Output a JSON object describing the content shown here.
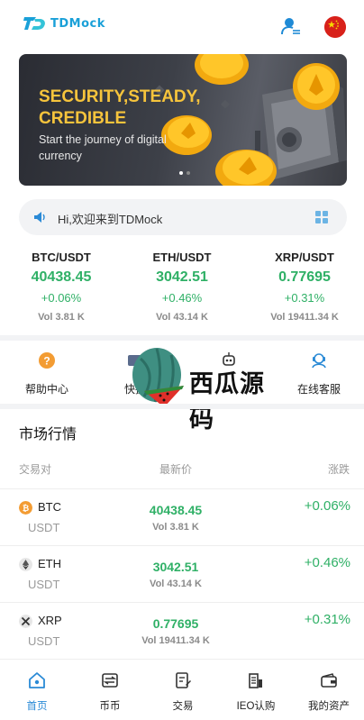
{
  "header": {
    "logo_text": "TDMock",
    "user_icon": "user-list-icon",
    "language_icon": "china-flag-icon"
  },
  "banner": {
    "title": "SECURITY,STEADY, CREDIBLE",
    "subtitle": "Start the journey of digital currency",
    "slides_count": 2,
    "active_slide": 1,
    "accent": "#f6c43c"
  },
  "notice": {
    "text": "Hi,欢迎来到TDMock"
  },
  "tickers": [
    {
      "pair": "BTC/USDT",
      "price": "40438.45",
      "change": "+0.06%",
      "volume": "Vol 3.81 K"
    },
    {
      "pair": "ETH/USDT",
      "price": "3042.51",
      "change": "+0.46%",
      "volume": "Vol 43.14 K"
    },
    {
      "pair": "XRP/USDT",
      "price": "0.77695",
      "change": "+0.31%",
      "volume": "Vol 19411.34 K"
    }
  ],
  "quick_menu": [
    {
      "label": "帮助中心",
      "icon": "help-icon"
    },
    {
      "label": "快捷",
      "icon": "card-icon"
    },
    {
      "label": "",
      "icon": "robot-icon"
    },
    {
      "label": "在线客服",
      "icon": "support-icon"
    }
  ],
  "watermark": {
    "text": "西瓜源码"
  },
  "market": {
    "title": "市场行情",
    "headers": {
      "pair": "交易对",
      "price": "最新价",
      "change": "涨跌"
    },
    "rows": [
      {
        "symbol": "BTC",
        "quote": "USDT",
        "price": "40438.45",
        "volume": "Vol 3.81 K",
        "change": "+0.06%",
        "icon": "btc-icon"
      },
      {
        "symbol": "ETH",
        "quote": "USDT",
        "price": "3042.51",
        "volume": "Vol 43.14 K",
        "change": "+0.46%",
        "icon": "eth-icon"
      },
      {
        "symbol": "XRP",
        "quote": "USDT",
        "price": "0.77695",
        "volume": "Vol 19411.34 K",
        "change": "+0.31%",
        "icon": "xrp-icon"
      }
    ]
  },
  "tabbar": [
    {
      "label": "首页",
      "icon": "home-icon",
      "active": true
    },
    {
      "label": "币币",
      "icon": "exchange-icon",
      "active": false
    },
    {
      "label": "交易",
      "icon": "trade-icon",
      "active": false
    },
    {
      "label": "IEO认购",
      "icon": "ieo-icon",
      "active": false
    },
    {
      "label": "我的资产",
      "icon": "wallet-icon",
      "active": false
    }
  ],
  "colors": {
    "up_green": "#2fb066",
    "brand_blue": "#1aa0d8",
    "tab_active": "#2a8ad6"
  }
}
